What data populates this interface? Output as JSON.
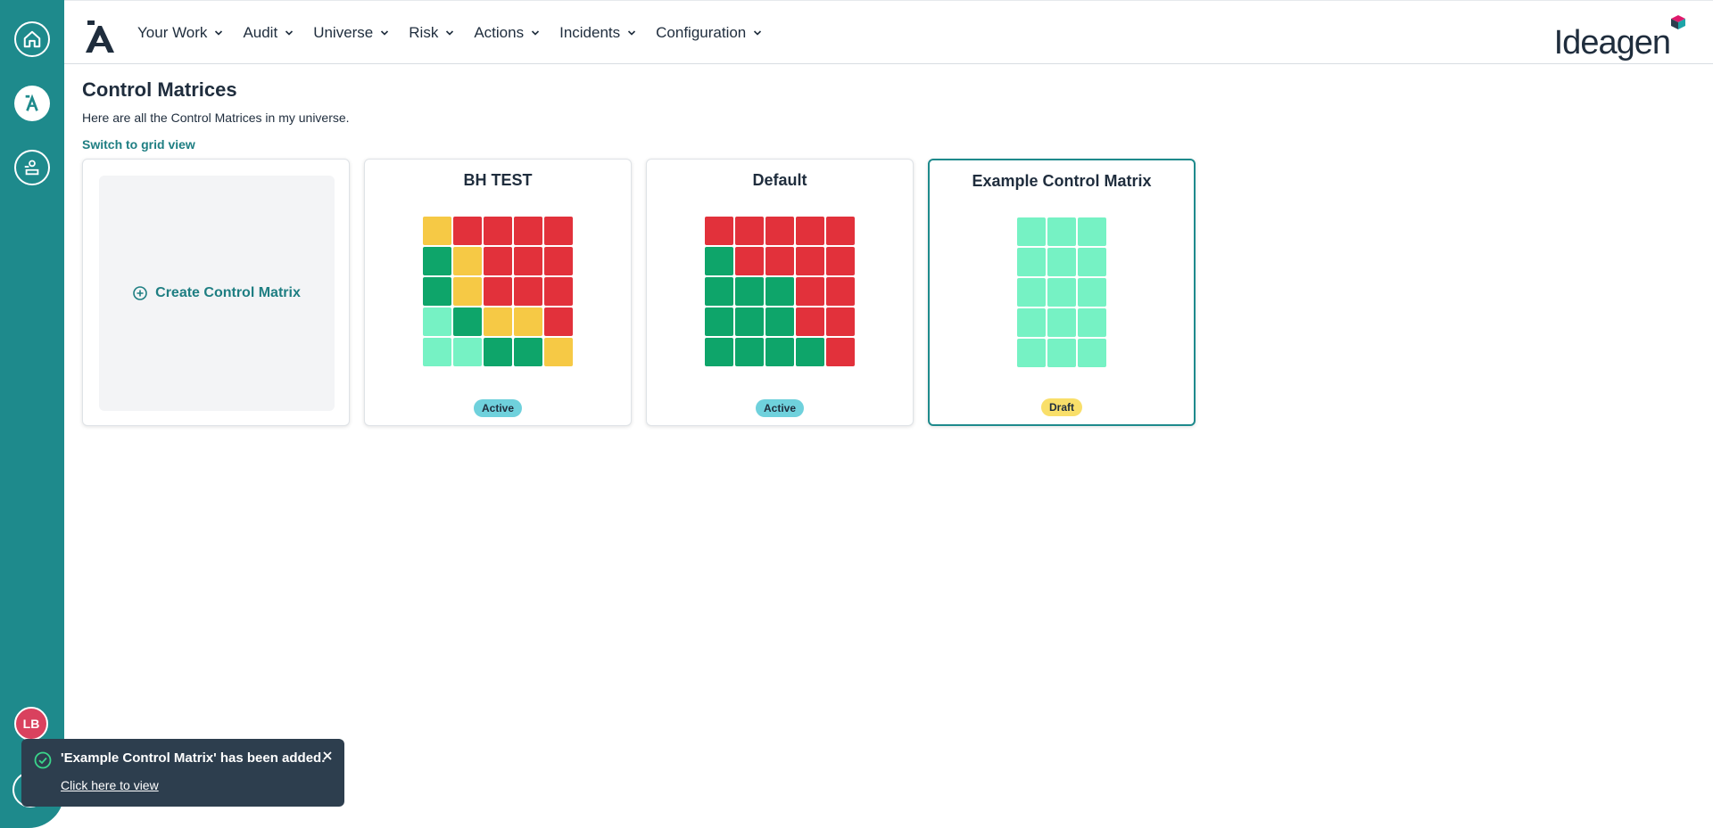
{
  "nav": {
    "items": [
      {
        "label": "Your Work"
      },
      {
        "label": "Audit"
      },
      {
        "label": "Universe"
      },
      {
        "label": "Risk"
      },
      {
        "label": "Actions"
      },
      {
        "label": "Incidents"
      },
      {
        "label": "Configuration"
      }
    ],
    "logo_text": "Ideagen"
  },
  "rail": {
    "avatar_initials": "LB",
    "icons": [
      "home-icon",
      "app-logo-icon",
      "user-org-icon"
    ]
  },
  "page": {
    "title": "Control Matrices",
    "subtitle": "Here are all the Control Matrices in my universe.",
    "grid_view_link": "Switch to grid view"
  },
  "create_card": {
    "label": "Create Control Matrix"
  },
  "colors": {
    "accent": "#1e8a8c",
    "R": "#e2313b",
    "Y": "#f6c945",
    "G": "#0ea56a",
    "L": "#76f2c4",
    "badge_active": "#6fd1dc",
    "badge_draft": "#f9df6a"
  },
  "matrices": [
    {
      "title": "BH TEST",
      "status": "Active",
      "cols": 5,
      "rows": [
        [
          "Y",
          "R",
          "R",
          "R",
          "R"
        ],
        [
          "G",
          "Y",
          "R",
          "R",
          "R"
        ],
        [
          "G",
          "Y",
          "R",
          "R",
          "R"
        ],
        [
          "L",
          "G",
          "Y",
          "Y",
          "R"
        ],
        [
          "L",
          "L",
          "G",
          "G",
          "Y"
        ]
      ]
    },
    {
      "title": "Default",
      "status": "Active",
      "cols": 5,
      "rows": [
        [
          "R",
          "R",
          "R",
          "R",
          "R"
        ],
        [
          "G",
          "R",
          "R",
          "R",
          "R"
        ],
        [
          "G",
          "G",
          "G",
          "R",
          "R"
        ],
        [
          "G",
          "G",
          "G",
          "R",
          "R"
        ],
        [
          "G",
          "G",
          "G",
          "G",
          "R"
        ]
      ]
    },
    {
      "title": "Example Control Matrix",
      "status": "Draft",
      "cols": 3,
      "rows": [
        [
          "L",
          "L",
          "L"
        ],
        [
          "L",
          "L",
          "L"
        ],
        [
          "L",
          "L",
          "L"
        ],
        [
          "L",
          "L",
          "L"
        ],
        [
          "L",
          "L",
          "L"
        ]
      ]
    }
  ],
  "toast": {
    "message": "'Example Control Matrix' has been added.",
    "link": "Click here to view"
  }
}
